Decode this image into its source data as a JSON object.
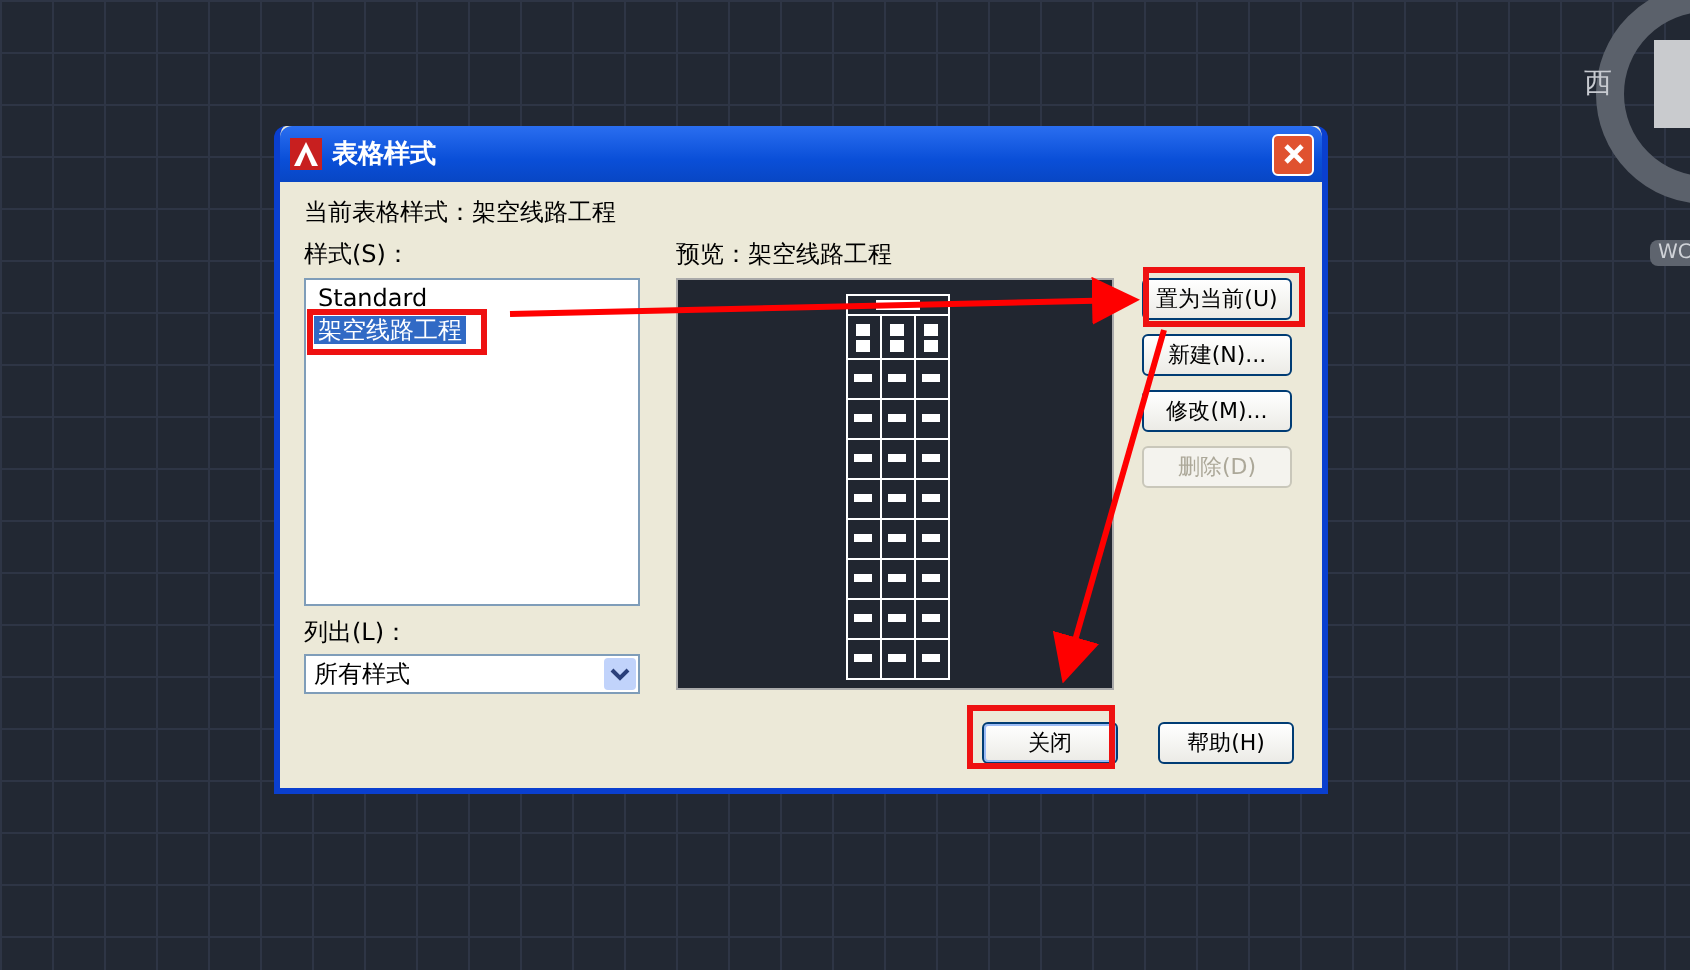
{
  "canvas": {
    "viewcube_label": "西",
    "ucs_badge": "WC"
  },
  "dialog": {
    "title": "表格样式",
    "current_style_label": "当前表格样式：架空线路工程",
    "styles_label": "样式(S)：",
    "styles": [
      {
        "name": "Standard",
        "selected": false
      },
      {
        "name": "架空线路工程",
        "selected": true
      }
    ],
    "preview_label": "预览：架空线路工程",
    "list_label": "列出(L)：",
    "list_filter": "所有样式",
    "buttons": [
      {
        "label": "置为当前(U)",
        "disabled": false
      },
      {
        "label": "新建(N)...",
        "disabled": false
      },
      {
        "label": "修改(M)...",
        "disabled": false
      },
      {
        "label": "删除(D)",
        "disabled": true
      }
    ],
    "footer_buttons": [
      {
        "label": "关闭"
      },
      {
        "label": "帮助(H)"
      }
    ]
  }
}
